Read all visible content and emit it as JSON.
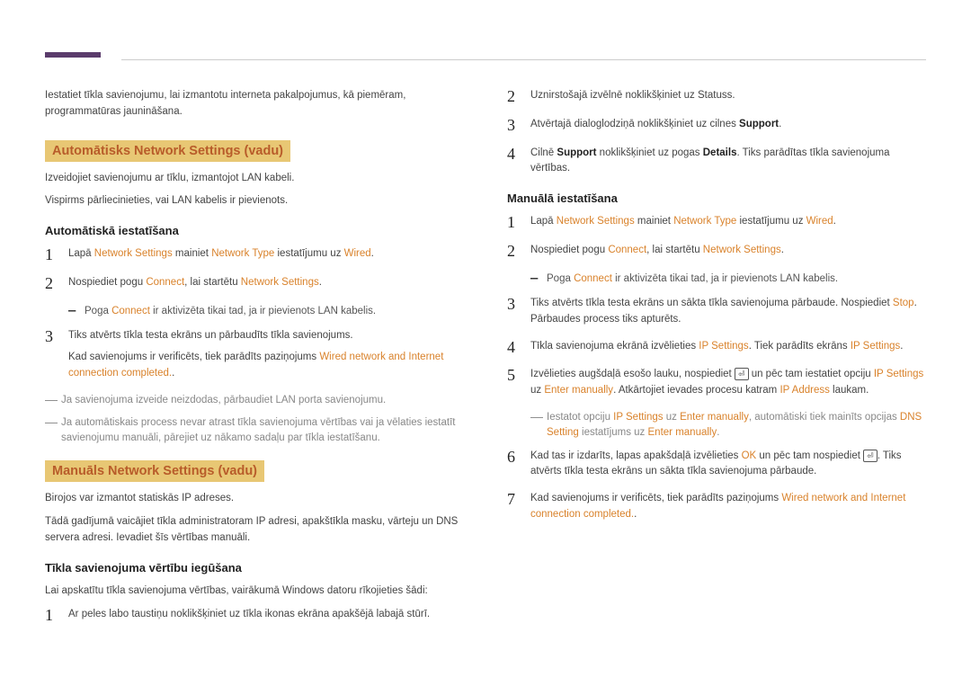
{
  "left": {
    "intro": "Iestatiet tīkla savienojumu, lai izmantotu interneta pakalpojumus, kā piemēram, programmatūras jaunināšana.",
    "sec1_title": "Automātisks Network Settings (vadu)",
    "sec1_p1": "Izveidojiet savienojumu ar tīklu, izmantojot LAN kabeli.",
    "sec1_p2": "Vispirms pārliecinieties, vai LAN kabelis ir pievienots.",
    "sec1_sub": "Automātiskā iestatīšana",
    "s1_1a": "Lapā ",
    "s1_1b": " mainiet ",
    "s1_1c": " iestatījumu uz ",
    "s1_2a": "Nospiediet pogu ",
    "s1_2b": ", lai startētu ",
    "s1_dash_a": "Poga ",
    "s1_dash_b": " ir aktivizēta tikai tad, ja ir pievienots LAN kabelis.",
    "s1_3": "Tiks atvērts tīkla testa ekrāns un pārbaudīts tīkla savienojums.",
    "s1_3p_a": "Kad savienojums ir verificēts, tiek parādīts paziņojums ",
    "s1_note1": "Ja savienojuma izveide neizdodas, pārbaudiet LAN porta savienojumu.",
    "s1_note2": "Ja automātiskais process nevar atrast tīkla savienojuma vērtības vai ja vēlaties iestatīt savienojumu manuāli, pārejiet uz nākamo sadaļu par tīkla iestatīšanu.",
    "sec2_title": "Manuāls Network Settings (vadu)",
    "sec2_p1": "Birojos var izmantot statiskās IP adreses.",
    "sec2_p2": "Tādā gadījumā vaicājiet tīkla administratoram IP adresi, apakštīkla masku, vārteju un DNS servera adresi. Ievadiet šīs vērtības manuāli.",
    "sec2_sub": "Tīkla savienojuma vērtību iegūšana",
    "sec2_p3": "Lai apskatītu tīkla savienojuma vērtības, vairākumā Windows datoru rīkojieties šādi:",
    "s2_1": "Ar peles labo taustiņu noklikšķiniet uz tīkla ikonas ekrāna apakšējā labajā stūrī."
  },
  "right": {
    "r2": "Uznirstošajā izvēlnē noklikšķiniet uz Statuss.",
    "r3a": "Atvērtajā dialoglodziņā noklikšķiniet uz cilnes ",
    "r4a": "Cilnē ",
    "r4b": " noklikšķiniet uz pogas ",
    "r4c": ". Tiks parādītas tīkla savienojuma vērtības.",
    "sub": "Manuālā iestatīšana",
    "m1a": "Lapā ",
    "m1b": " mainiet ",
    "m1c": " iestatījumu uz ",
    "m2a": "Nospiediet pogu ",
    "m2b": ", lai startētu ",
    "m_dash_a": "Poga ",
    "m_dash_b": " ir aktivizēta tikai tad, ja ir pievienots LAN kabelis.",
    "m3a": "Tiks atvērts tīkla testa ekrāns un sākta tīkla savienojuma pārbaude. Nospiediet ",
    "m3b": ". Pārbaudes process tiks apturēts.",
    "m4a": "Tīkla savienojuma ekrānā izvēlieties ",
    "m4b": ". Tiek parādīts ekrāns ",
    "m5a": "Izvēlieties augšdaļā esošo lauku, nospiediet ",
    "m5b": " un pēc tam iestatiet opciju ",
    "m5c": " uz ",
    "m5d": ". Atkārtojiet ievades procesu katram ",
    "m5e": " laukam.",
    "m_note_a": "Iestatot opciju ",
    "m_note_b": " uz ",
    "m_note_c": ", automātiski tiek mainīts opcijas ",
    "m_note_d": " iestatījums uz ",
    "m6a": "Kad tas ir izdarīts, lapas apakšdaļā izvēlieties ",
    "m6b": " un pēc tam nospiediet ",
    "m6c": ". Tiks atvērts tīkla testa ekrāns un sākta tīkla savienojuma pārbaude.",
    "m7a": "Kad savienojums ir verificēts, tiek parādīts paziņojums "
  },
  "kw": {
    "network_settings": "Network Settings",
    "network_type": "Network Type",
    "wired": "Wired",
    "connect": "Connect",
    "wired_complete": "Wired network and Internet connection completed.",
    "support": "Support",
    "details": "Details",
    "stop": "Stop",
    "ip_settings": "IP Settings",
    "enter_manually": "Enter manually",
    "ip_address": "IP Address",
    "dns_setting": "DNS Setting",
    "ok": "OK"
  },
  "icons": {
    "enter": "⏎",
    "play": "▶"
  }
}
